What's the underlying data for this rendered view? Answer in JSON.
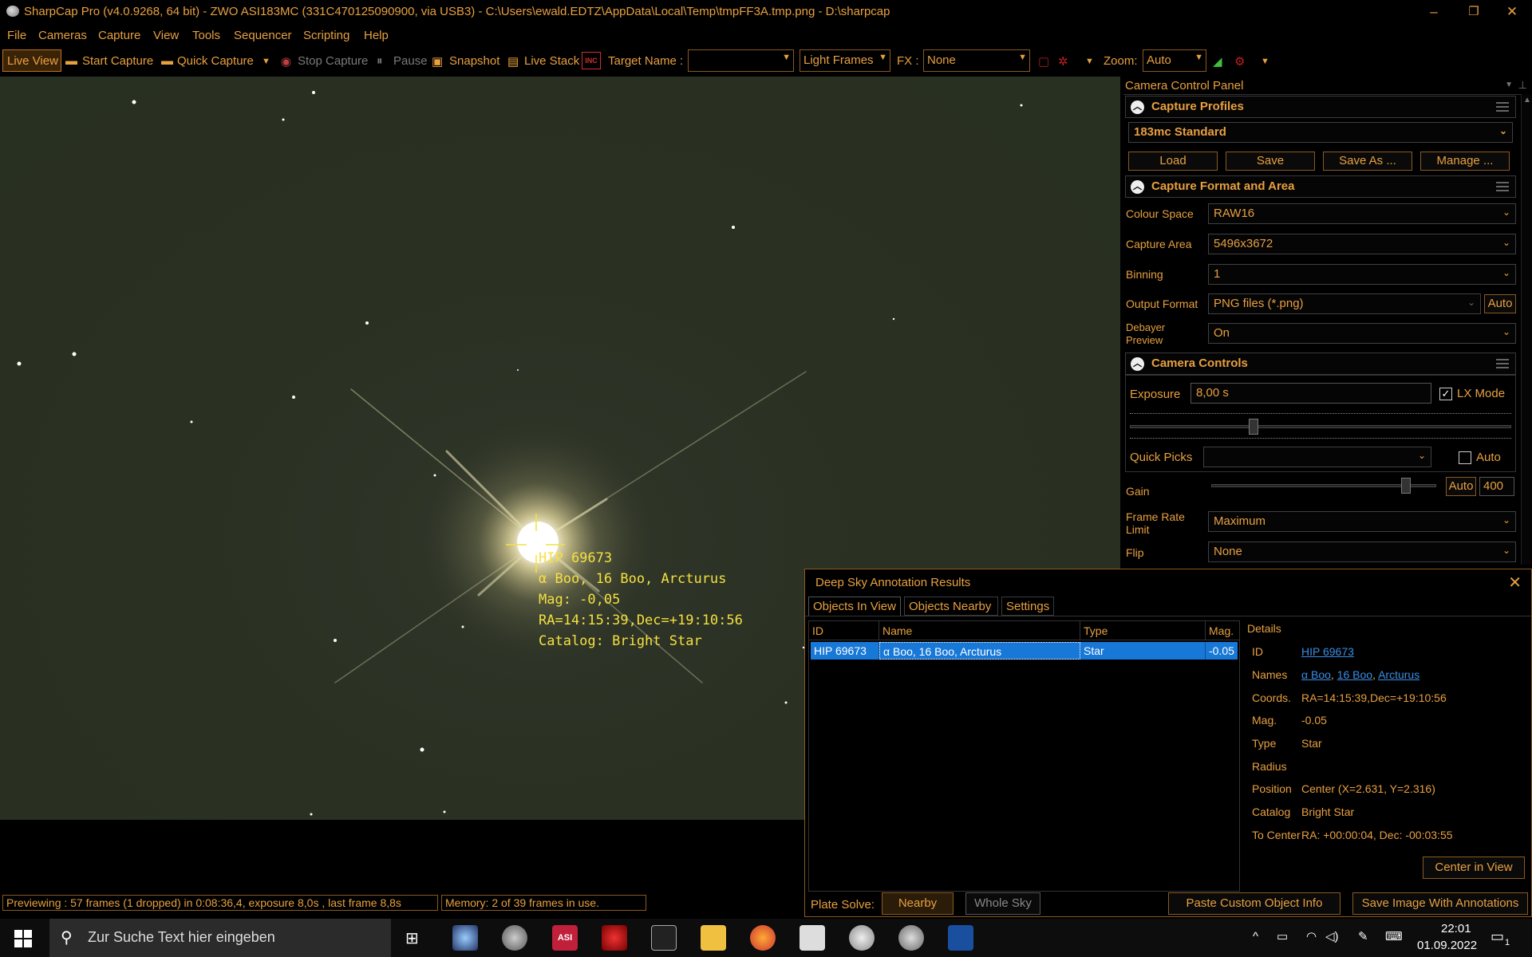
{
  "window": {
    "title": "SharpCap Pro (v4.0.9268, 64 bit) - ZWO ASI183MC (331C470125090900, via USB3) - C:\\Users\\ewald.EDTZ\\AppData\\Local\\Temp\\tmpFF3A.tmp.png - D:\\sharpcap",
    "minimize": "–",
    "restore": "❐",
    "close": "✕"
  },
  "menu": [
    "File",
    "Cameras",
    "Capture",
    "View",
    "Tools",
    "Sequencer",
    "Scripting",
    "Help"
  ],
  "toolbar": {
    "live_view": "Live View",
    "start_capture": "Start Capture",
    "quick_capture": "Quick Capture",
    "stop_capture": "Stop Capture",
    "pause": "Pause",
    "snapshot": "Snapshot",
    "live_stack": "Live Stack",
    "target_name_label": "Target Name :",
    "target_name_value": "",
    "frame_type": "Light Frames",
    "fx_label": "FX :",
    "fx_value": "None",
    "zoom_label": "Zoom:",
    "zoom_value": "Auto",
    "inc_icon_text": "INC"
  },
  "annotation": {
    "line1": "HIP 69673",
    "line2": "α Boo, 16 Boo, Arcturus",
    "line3": "Mag: -0,05",
    "line4": "RA=14:15:39,Dec=+19:10:56",
    "line5": "Catalog: Bright Star"
  },
  "panel": {
    "title": "Camera Control Panel",
    "capture_profiles": {
      "heading": "Capture Profiles",
      "selected": "183mc Standard",
      "load": "Load",
      "save": "Save",
      "save_as": "Save As ...",
      "manage": "Manage ..."
    },
    "capture_format": {
      "heading": "Capture Format and Area",
      "colour_space_label": "Colour Space",
      "colour_space": "RAW16",
      "capture_area_label": "Capture Area",
      "capture_area": "5496x3672",
      "binning_label": "Binning",
      "binning": "1",
      "output_format_label": "Output Format",
      "output_format": "PNG files (*.png)",
      "output_auto": "Auto",
      "debayer_label_1": "Debayer",
      "debayer_label_2": "Preview",
      "debayer": "On"
    },
    "camera_controls": {
      "heading": "Camera Controls",
      "exposure_label": "Exposure",
      "exposure": "8,00 s",
      "lx_mode": "LX Mode",
      "lx_mode_checked": true,
      "quick_picks_label": "Quick Picks",
      "quick_picks": "",
      "quick_auto": "Auto",
      "gain_label": "Gain",
      "gain_auto": "Auto",
      "gain": "400",
      "gain_level": 0.88,
      "exposure_level": 0.32,
      "frame_rate_label_1": "Frame Rate",
      "frame_rate_label_2": "Limit",
      "frame_rate": "Maximum",
      "flip_label": "Flip",
      "flip": "None"
    }
  },
  "dialog": {
    "title": "Deep Sky Annotation Results",
    "tabs": [
      "Objects In View",
      "Objects Nearby",
      "Settings"
    ],
    "columns": [
      "ID",
      "Name",
      "Type",
      "Mag."
    ],
    "rows": [
      {
        "id": "HIP 69673",
        "name": "α Boo, 16 Boo, Arcturus",
        "type": "Star",
        "mag": "-0.05"
      }
    ],
    "details": {
      "heading": "Details",
      "id_label": "ID",
      "id": "HIP 69673",
      "names_label": "Names",
      "names": [
        "α Boo",
        "16 Boo",
        "Arcturus"
      ],
      "coords_label": "Coords.",
      "coords": "RA=14:15:39,Dec=+19:10:56",
      "mag_label": "Mag.",
      "mag": "-0.05",
      "type_label": "Type",
      "type": "Star",
      "radius_label": "Radius",
      "radius": "",
      "position_label": "Position",
      "position": "Center (X=2.631, Y=2.316)",
      "catalog_label": "Catalog",
      "catalog": "Bright Star",
      "to_center_label": "To Center",
      "to_center": "RA: +00:00:04, Dec: -00:03:55",
      "center_button": "Center in View"
    },
    "plate_solve_label": "Plate Solve:",
    "nearby": "Nearby",
    "whole_sky": "Whole Sky",
    "paste_custom": "Paste Custom Object Info",
    "save_image": "Save Image With Annotations"
  },
  "status": {
    "previewing": "Previewing : 57 frames (1 dropped) in 0:08:36,4, exposure 8,0s , last frame 8,8s",
    "memory": "Memory: 2 of 39 frames in use."
  },
  "taskbar": {
    "search_placeholder": "Zur Suche Text hier eingeben",
    "time": "22:01",
    "date": "01.09.2022",
    "notification_count": "1",
    "asi_label": "ASI"
  }
}
